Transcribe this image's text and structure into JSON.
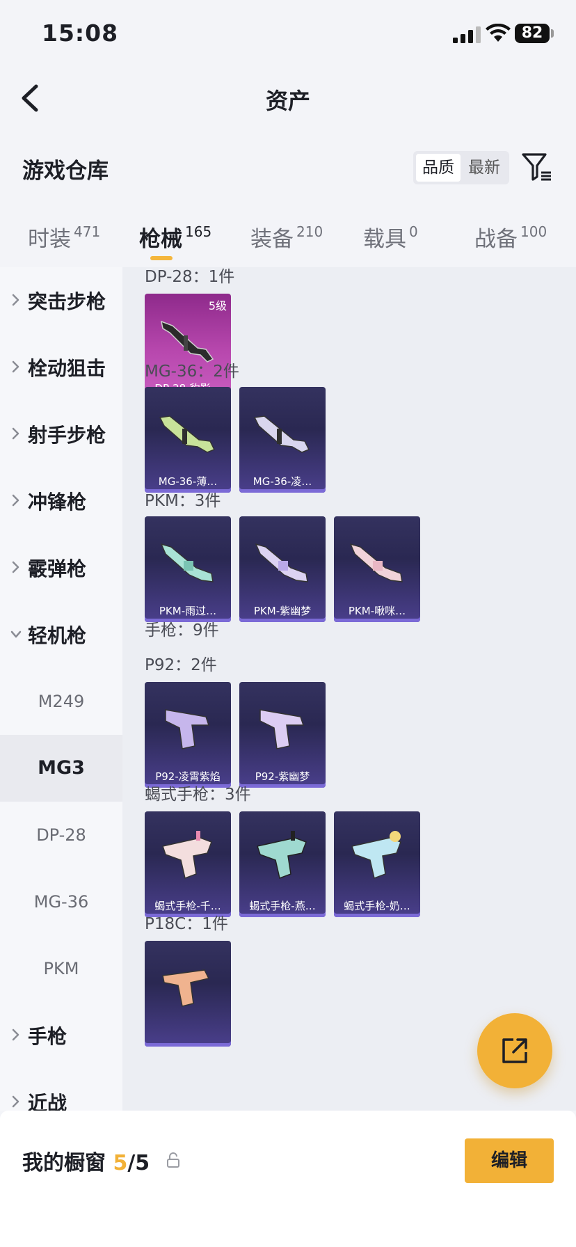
{
  "status": {
    "time": "15:08",
    "battery": "82"
  },
  "nav": {
    "title": "资产"
  },
  "warehouse": {
    "label": "游戏仓库",
    "sort_options": [
      "品质",
      "最新"
    ]
  },
  "tabs": [
    {
      "label": "时装",
      "count": "471"
    },
    {
      "label": "枪械",
      "count": "165"
    },
    {
      "label": "装备",
      "count": "210"
    },
    {
      "label": "载具",
      "count": "0"
    },
    {
      "label": "战备",
      "count": "100"
    }
  ],
  "sidebar": {
    "categories": [
      {
        "label": "突击步枪",
        "expanded": false
      },
      {
        "label": "栓动狙击",
        "expanded": false
      },
      {
        "label": "射手步枪",
        "expanded": false
      },
      {
        "label": "冲锋枪",
        "expanded": false
      },
      {
        "label": "霰弹枪",
        "expanded": false
      },
      {
        "label": "轻机枪",
        "expanded": true
      },
      {
        "label": "手枪",
        "expanded": false
      },
      {
        "label": "近战",
        "expanded": false
      }
    ],
    "subitems": [
      "M249",
      "MG3",
      "DP-28",
      "MG-36",
      "PKM"
    ],
    "active_subitem": "MG3"
  },
  "content": {
    "sections": [
      {
        "title": "DP-28：1件",
        "items": [
          {
            "caption": "DP-28-豹影…",
            "level": "5级",
            "rarity": "pink"
          }
        ]
      },
      {
        "title": "MG-36：2件",
        "items": [
          {
            "caption": "MG-36-薄…"
          },
          {
            "caption": "MG-36-凌…"
          }
        ]
      },
      {
        "title": "PKM：3件",
        "items": [
          {
            "caption": "PKM-雨过…"
          },
          {
            "caption": "PKM-紫幽梦"
          },
          {
            "caption": "PKM-啾咪…"
          }
        ]
      },
      {
        "title": "手枪：9件",
        "items": []
      },
      {
        "title": "P92：2件",
        "items": [
          {
            "caption": "P92-凌霄紫焰"
          },
          {
            "caption": "P92-紫幽梦"
          }
        ]
      },
      {
        "title": "蝎式手枪：3件",
        "items": [
          {
            "caption": "蝎式手枪-千…"
          },
          {
            "caption": "蝎式手枪-燕…"
          },
          {
            "caption": "蝎式手枪-奶…"
          }
        ]
      },
      {
        "title": "P18C：1件",
        "items": [
          {
            "caption": ""
          }
        ]
      }
    ]
  },
  "bottom": {
    "label": "我的橱窗",
    "current": "5",
    "total": "/5",
    "edit_label": "编辑"
  },
  "colors": {
    "accent": "#f2b137",
    "card_purple": "#2f2d5a",
    "card_pink": "#b848ae"
  }
}
